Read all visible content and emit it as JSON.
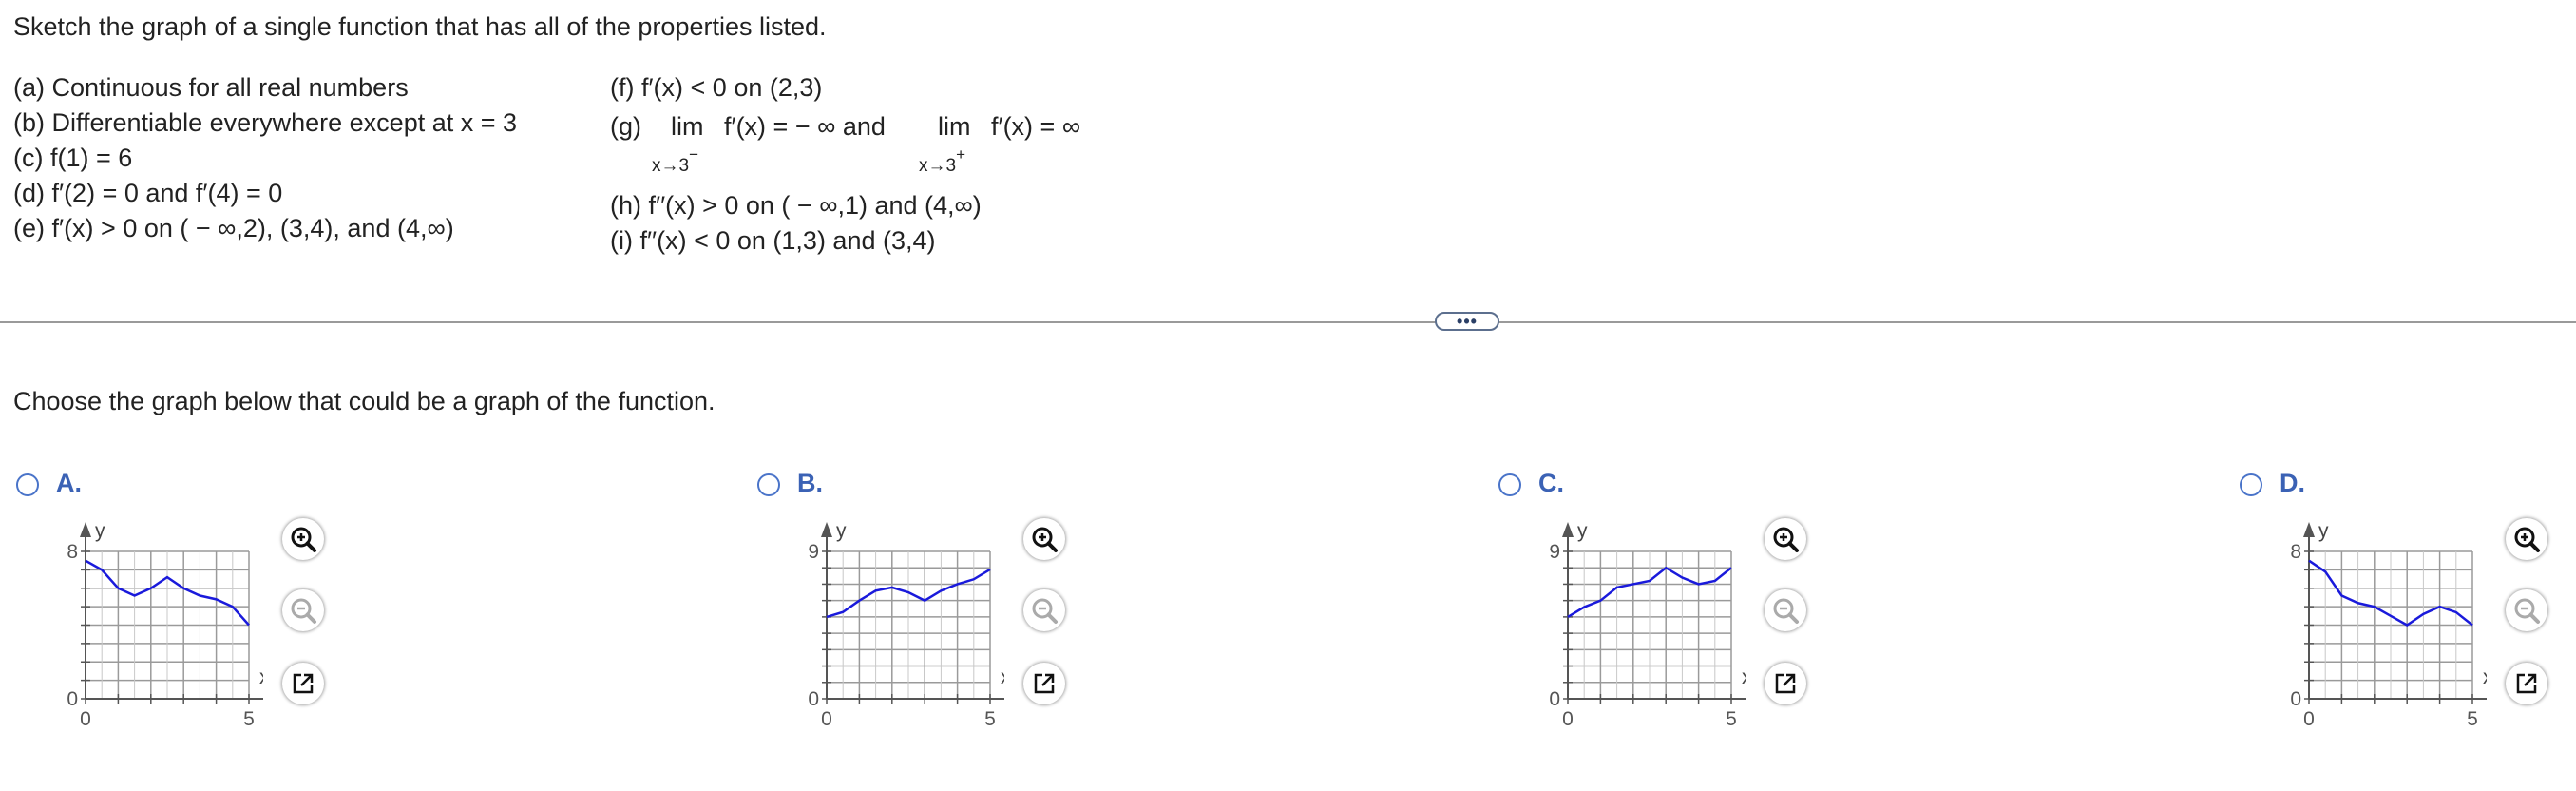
{
  "question": {
    "prompt": "Sketch the graph of a single function that has all of the properties listed.",
    "props_left": [
      "(a) Continuous for all real numbers",
      "(b) Differentiable everywhere except at x = 3",
      "(c) f(1) = 6",
      "(d) f′(2) = 0 and f′(4) = 0",
      "(e) f′(x) > 0 on ( − ∞,2), (3,4), and (4,∞)"
    ],
    "prop_f": "(f) f′(x) < 0 on (2,3)",
    "prop_g": {
      "label": "(g)",
      "lim1": "lim",
      "expr1": "f′(x) = − ∞ and",
      "lim2": "lim",
      "expr2": "f′(x) = ∞",
      "sub1": "x→3",
      "sup1": "−",
      "sub2": "x→3",
      "sup2": "+"
    },
    "prop_h": "(h) f′′(x) > 0 on ( − ∞,1) and (4,∞)",
    "prop_i": "(i) f′′(x) < 0 on (1,3) and (3,4)"
  },
  "more_button": "•••",
  "instruction": "Choose the graph below that could be a graph of the function.",
  "colors": {
    "accent": "#3b62b5",
    "curve": "#1a1adb"
  },
  "options": [
    {
      "letter": "A.",
      "ymax_label": "8",
      "y0_label": "0",
      "x0_label": "0",
      "x5_label": "5",
      "y_axis": "y",
      "x_axis": "x",
      "ymax": 8,
      "curve_points": [
        [
          0,
          7.5
        ],
        [
          0.5,
          7.0
        ],
        [
          1,
          6.0
        ],
        [
          1.5,
          5.6
        ],
        [
          2,
          6.0
        ],
        [
          2.5,
          6.6
        ],
        [
          3,
          6.0
        ],
        [
          3.5,
          5.6
        ],
        [
          4,
          5.4
        ],
        [
          4.5,
          5.0
        ],
        [
          5,
          4.0
        ]
      ]
    },
    {
      "letter": "B.",
      "ymax_label": "9",
      "y0_label": "0",
      "x0_label": "0",
      "x5_label": "5",
      "y_axis": "y",
      "x_axis": "x",
      "ymax": 9,
      "curve_points": [
        [
          0,
          5.0
        ],
        [
          0.5,
          5.3
        ],
        [
          1,
          6.0
        ],
        [
          1.5,
          6.6
        ],
        [
          2,
          6.8
        ],
        [
          2.5,
          6.5
        ],
        [
          3,
          6.0
        ],
        [
          3.5,
          6.6
        ],
        [
          4,
          7.0
        ],
        [
          4.5,
          7.3
        ],
        [
          5,
          7.9
        ]
      ]
    },
    {
      "letter": "C.",
      "ymax_label": "9",
      "y0_label": "0",
      "x0_label": "0",
      "x5_label": "5",
      "y_axis": "y",
      "x_axis": "x",
      "ymax": 9,
      "curve_points": [
        [
          0,
          5.0
        ],
        [
          0.5,
          5.6
        ],
        [
          1,
          6.0
        ],
        [
          1.5,
          6.8
        ],
        [
          2,
          7.0
        ],
        [
          2.5,
          7.2
        ],
        [
          3,
          8.0
        ],
        [
          3.5,
          7.4
        ],
        [
          4,
          7.0
        ],
        [
          4.5,
          7.2
        ],
        [
          5,
          8.0
        ]
      ]
    },
    {
      "letter": "D.",
      "ymax_label": "8",
      "y0_label": "0",
      "x0_label": "0",
      "x5_label": "5",
      "y_axis": "y",
      "x_axis": "x",
      "ymax": 8,
      "curve_points": [
        [
          0,
          7.5
        ],
        [
          0.5,
          6.9
        ],
        [
          1,
          5.6
        ],
        [
          1.5,
          5.2
        ],
        [
          2,
          5.0
        ],
        [
          2.5,
          4.5
        ],
        [
          3,
          4.0
        ],
        [
          3.5,
          4.6
        ],
        [
          4,
          5.0
        ],
        [
          4.5,
          4.7
        ],
        [
          5,
          4.0
        ]
      ]
    }
  ]
}
